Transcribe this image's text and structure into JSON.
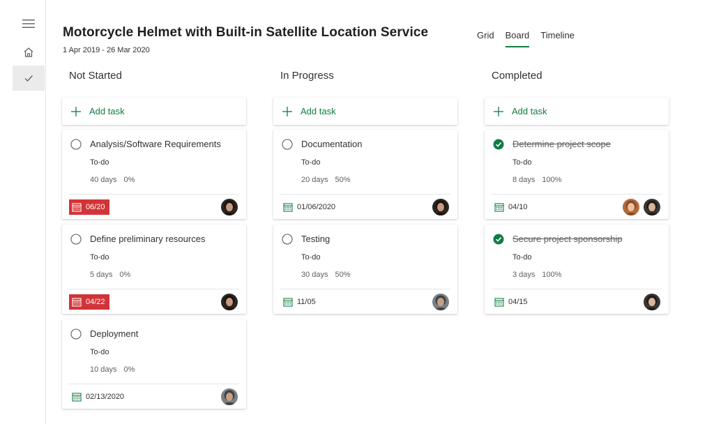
{
  "plan": {
    "title": "Motorcycle Helmet with Built-in Satellite Location Service",
    "dates": "1 Apr 2019 - 26 Mar 2020"
  },
  "views": [
    "Grid",
    "Board",
    "Timeline"
  ],
  "active_view": "Board",
  "add_task_label": "Add task",
  "colors": {
    "accent": "#107c41",
    "overdue": "#d13438"
  },
  "columns": [
    {
      "title": "Not Started",
      "tasks": [
        {
          "name": "Analysis/Software Requirements",
          "bucket": "To-do",
          "duration": "40 days",
          "progress": "0%",
          "due": "06/20",
          "overdue": true,
          "done": false,
          "assignees": [
            "avatar-woman-dark-hair"
          ]
        },
        {
          "name": "Define preliminary resources",
          "bucket": "To-do",
          "duration": "5 days",
          "progress": "0%",
          "due": "04/22",
          "overdue": true,
          "done": false,
          "assignees": [
            "avatar-woman-dark-hair"
          ]
        },
        {
          "name": "Deployment",
          "bucket": "To-do",
          "duration": "10 days",
          "progress": "0%",
          "due": "02/13/2020",
          "overdue": false,
          "done": false,
          "assignees": [
            "avatar-man-grey"
          ]
        }
      ]
    },
    {
      "title": "In Progress",
      "tasks": [
        {
          "name": "Documentation",
          "bucket": "To-do",
          "duration": "20 days",
          "progress": "50%",
          "due": "01/06/2020",
          "overdue": false,
          "done": false,
          "assignees": [
            "avatar-woman-dark-hair"
          ]
        },
        {
          "name": "Testing",
          "bucket": "To-do",
          "duration": "30 days",
          "progress": "50%",
          "due": "11/05",
          "overdue": false,
          "done": false,
          "assignees": [
            "avatar-man-grey"
          ]
        }
      ]
    },
    {
      "title": "Completed",
      "tasks": [
        {
          "name": "Determine project scope",
          "bucket": "To-do",
          "duration": "8 days",
          "progress": "100%",
          "due": "04/10",
          "overdue": false,
          "done": true,
          "assignees": [
            "avatar-woman-light-hair",
            "avatar-man-dark-hair"
          ]
        },
        {
          "name": "Secure project sponsorship",
          "bucket": "To-do",
          "duration": "3 days",
          "progress": "100%",
          "due": "04/15",
          "overdue": false,
          "done": true,
          "assignees": [
            "avatar-man-dark-hair"
          ]
        }
      ]
    }
  ]
}
